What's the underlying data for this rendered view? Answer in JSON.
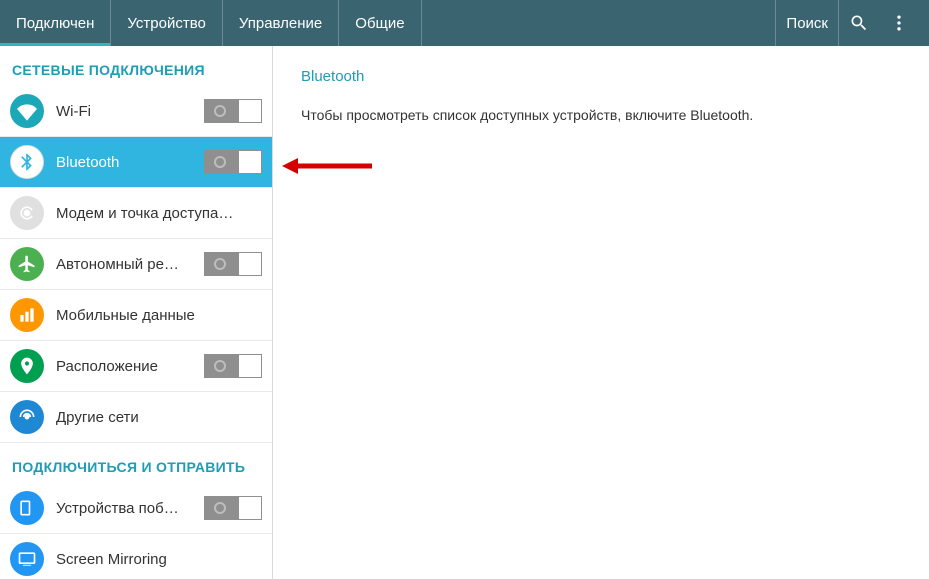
{
  "header": {
    "tabs": [
      {
        "label": "Подключен",
        "active": true
      },
      {
        "label": "Устройство",
        "active": false
      },
      {
        "label": "Управление",
        "active": false
      },
      {
        "label": "Общие",
        "active": false
      }
    ],
    "search_label": "Поиск"
  },
  "sidebar": {
    "sections": [
      {
        "title": "СЕТЕВЫЕ ПОДКЛЮЧЕНИЯ",
        "items": [
          {
            "icon": "wifi",
            "label": "Wi-Fi",
            "toggle": "off",
            "color": "teal"
          },
          {
            "icon": "bluetooth",
            "label": "Bluetooth",
            "toggle": "off",
            "color": "white",
            "selected": true
          },
          {
            "icon": "hotspot",
            "label": "Модем и точка доступа…",
            "toggle": null,
            "color": "gray"
          },
          {
            "icon": "airplane",
            "label": "Автономный ре…",
            "toggle": "off",
            "color": "green"
          },
          {
            "icon": "data",
            "label": "Мобильные данные",
            "toggle": null,
            "color": "orange"
          },
          {
            "icon": "location",
            "label": "Расположение",
            "toggle": "off",
            "color": "green2"
          },
          {
            "icon": "more-networks",
            "label": "Другие сети",
            "toggle": null,
            "color": "blue"
          }
        ]
      },
      {
        "title": "ПОДКЛЮЧИТЬСЯ И ОТПРАВИТЬ",
        "items": [
          {
            "icon": "nearby",
            "label": "Устройства поб…",
            "toggle": "off",
            "color": "blue2"
          },
          {
            "icon": "mirroring",
            "label": "Screen Mirroring",
            "toggle": null,
            "color": "blue2"
          }
        ]
      }
    ]
  },
  "content": {
    "title": "Bluetooth",
    "text": "Чтобы просмотреть список доступных устройств, включите Bluetooth."
  }
}
